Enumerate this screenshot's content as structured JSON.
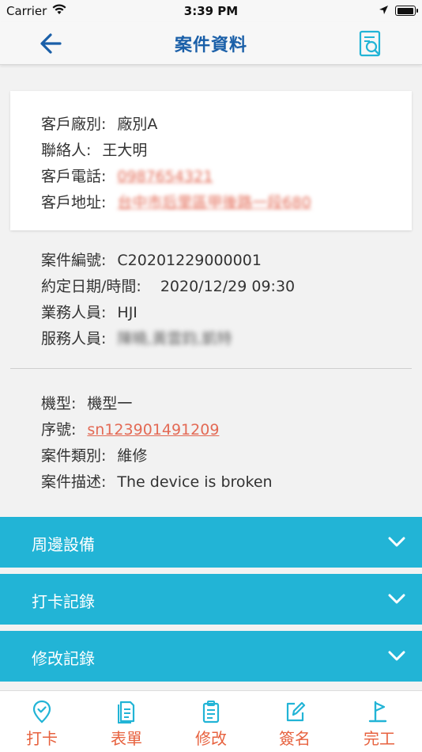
{
  "status_bar": {
    "carrier": "Carrier",
    "time": "3:39 PM"
  },
  "nav": {
    "title": "案件資料"
  },
  "customer": {
    "factory_label": "客戶廠別:",
    "factory_value": "廠別A",
    "contact_label": "聯絡人:",
    "contact_value": "王大明",
    "phone_label": "客戶電話:",
    "phone_value": "0987654321",
    "address_label": "客戶地址:",
    "address_value": "台中市后里區甲後路一段680"
  },
  "case": {
    "number_label": "案件編號:",
    "number_value": "C20201229000001",
    "date_label": "約定日期/時間:",
    "date_value": "2020/12/29 09:30",
    "sales_label": "業務人員:",
    "sales_value": "HJI",
    "service_label": "服務人員:",
    "service_value": "陳曉,黃雲鈞,凱特"
  },
  "device": {
    "model_label": "機型:",
    "model_value": "機型一",
    "serial_label": "序號:",
    "serial_value": "sn123901491209",
    "type_label": "案件類別:",
    "type_value": "維修",
    "desc_label": "案件描述:",
    "desc_value": "The device is broken"
  },
  "accordions": [
    {
      "label": "周邊設備"
    },
    {
      "label": "打卡記錄"
    },
    {
      "label": "修改記錄"
    }
  ],
  "tabs": [
    {
      "label": "打卡",
      "icon": "location-pin-icon"
    },
    {
      "label": "表單",
      "icon": "document-icon"
    },
    {
      "label": "修改",
      "icon": "clipboard-icon"
    },
    {
      "label": "簽名",
      "icon": "edit-icon"
    },
    {
      "label": "完工",
      "icon": "flag-icon"
    }
  ],
  "colors": {
    "accent_blue": "#1a5fa8",
    "accordion_bg": "#22b4d6",
    "tab_orange": "#e7623f",
    "link_red": "#e36a55"
  }
}
